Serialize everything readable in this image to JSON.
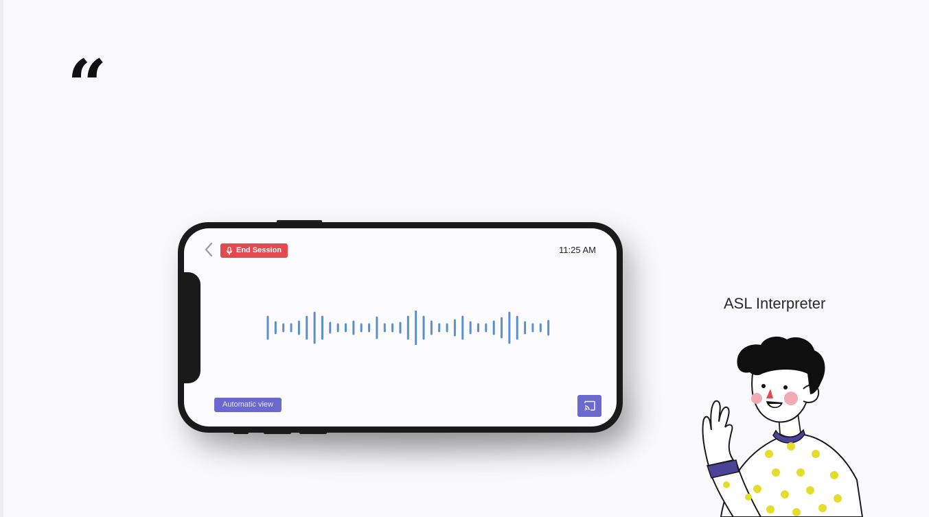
{
  "quote": {
    "mark": "“"
  },
  "phone": {
    "end_session_label": "End Session",
    "time": "11:25 AM",
    "automatic_view_label": "Automatic view",
    "icons": {
      "back": "chevron-left-icon",
      "mic": "microphone-icon",
      "cast": "cast-icon"
    },
    "colors": {
      "end_session_bg": "#e24a4f",
      "accent": "#6b68cf",
      "wave": "#5b8fc9"
    }
  },
  "interpreter": {
    "label": "ASL Interpreter"
  }
}
